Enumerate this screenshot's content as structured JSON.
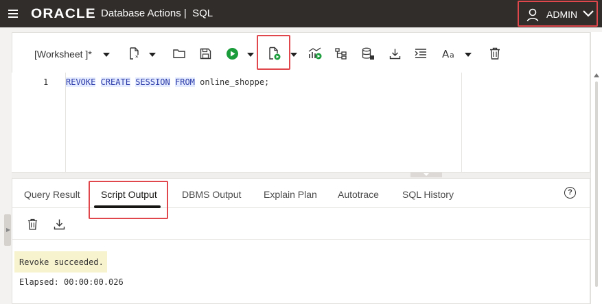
{
  "header": {
    "brand": "ORACLE",
    "title": "Database Actions |  SQL",
    "user": "ADMIN"
  },
  "toolbar": {
    "worksheet_label": "[Worksheet ]*"
  },
  "editor": {
    "line_number": "1",
    "code": {
      "kw1": "REVOKE",
      "kw2": "CREATE",
      "kw3": "SESSION",
      "kw4": "FROM",
      "rest": "online_shoppe;"
    }
  },
  "tabs": [
    {
      "label": "Query Result"
    },
    {
      "label": "Script Output"
    },
    {
      "label": "DBMS Output"
    },
    {
      "label": "Explain Plan"
    },
    {
      "label": "Autotrace"
    },
    {
      "label": "SQL History"
    }
  ],
  "help_glyph": "?",
  "output": {
    "message": "Revoke succeeded.",
    "elapsed": "Elapsed: 00:00:00.026"
  },
  "colors": {
    "header_bg": "#312d2a",
    "highlight": "#e0474c",
    "run_green": "#1a9c3b",
    "message_bg": "#f8f3cf"
  }
}
